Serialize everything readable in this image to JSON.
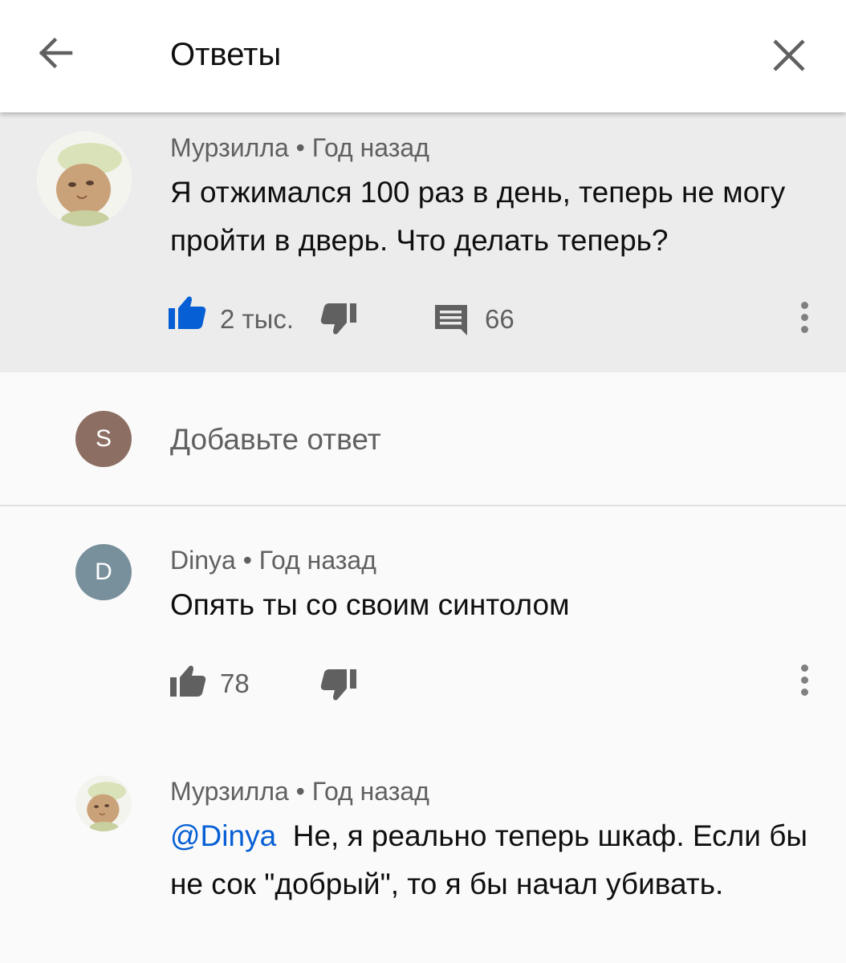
{
  "header": {
    "title": "Ответы",
    "back_icon": "arrow-left-icon",
    "close_icon": "close-icon"
  },
  "parent_comment": {
    "author": "Мурзилла",
    "separator": "•",
    "time": "Год назад",
    "text": "Я отжимался 100 раз в день, теперь не могу пройти в дверь. Что делать теперь?",
    "likes": "2 тыс.",
    "liked": true,
    "replies": "66",
    "accent_color": "#065fd4"
  },
  "add_reply": {
    "avatar_letter": "S",
    "avatar_color": "#8d6e63",
    "placeholder": "Добавьте ответ"
  },
  "replies": [
    {
      "author": "Dinya",
      "separator": "•",
      "time": "Год назад",
      "avatar_letter": "D",
      "avatar_color": "#78909c",
      "text": "Опять ты со своим синтолом",
      "likes": "78"
    },
    {
      "author": "Мурзилла",
      "separator": "•",
      "time": "Год назад",
      "mention": "@Dinya",
      "text": "Не, я реально теперь шкаф. Если бы не сок \"добрый\", то я бы начал убивать."
    }
  ]
}
